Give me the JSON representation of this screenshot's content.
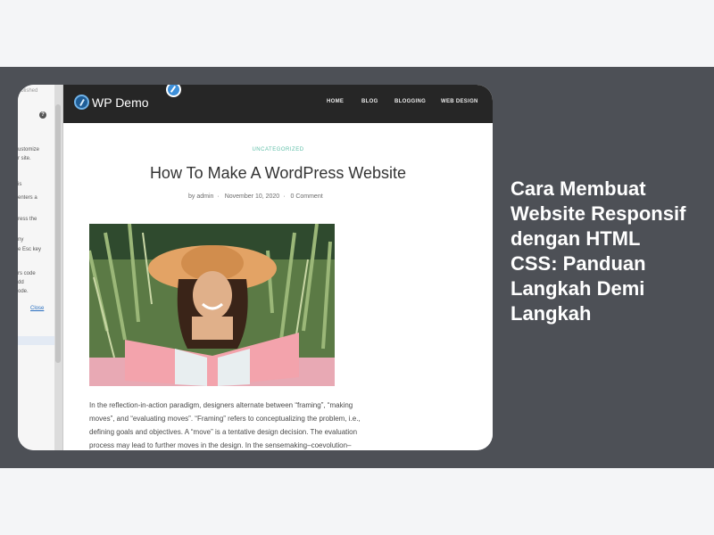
{
  "panel": {
    "top_text": "ublished",
    "lines": [
      "ustomize",
      "r site.",
      "is",
      "enters a",
      "ress the",
      "ny",
      "e Esc key",
      "rs code",
      "dd",
      "ode."
    ],
    "close_label": "Close"
  },
  "site": {
    "title": "WP Demo",
    "nav": [
      "HOME",
      "BLOG",
      "BLOGGING",
      "WEB DESIGN"
    ]
  },
  "post": {
    "category": "UNCATEGORIZED",
    "title": "How To Make A WordPress Website",
    "author": "by admin",
    "date": "November 10, 2020",
    "comments": "0 Comment",
    "body_lines": [
      "In the reflection-in-action paradigm, designers alternate between “framing”, “making",
      "moves”, and “evaluating moves”. “Framing” refers to conceptualizing the problem, i.e.,",
      "defining goals and objectives. A “move” is a tentative design decision. The evaluation",
      "process may lead to further moves in the design. In the sensemaking–coevolution–"
    ]
  },
  "headline": "Cara Membuat Website Responsif dengan HTML CSS: Panduan Langkah Demi Langkah",
  "colors": {
    "band": "#4d5056",
    "page_bg": "#f4f5f7",
    "site_header": "#262626",
    "category": "#5fbfa8"
  }
}
